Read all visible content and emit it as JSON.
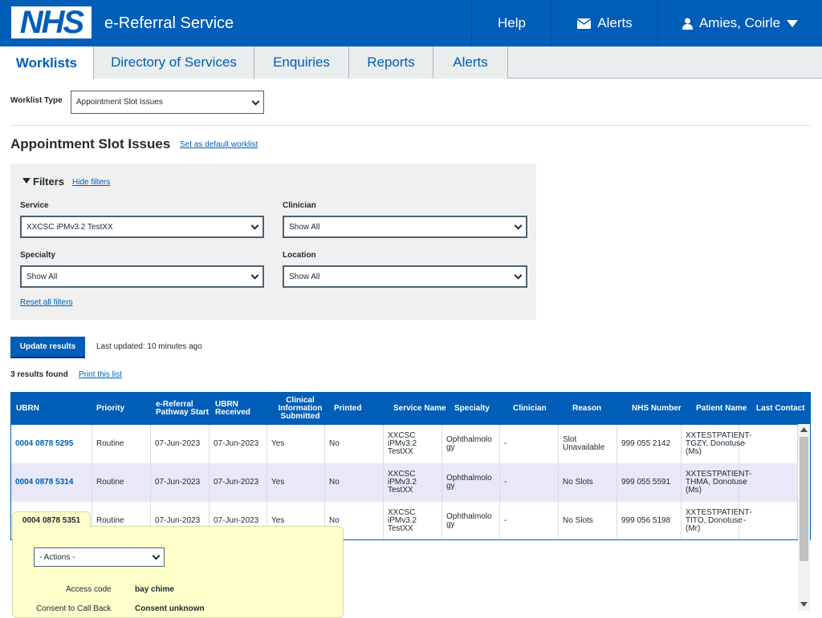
{
  "header": {
    "logo": "NHS",
    "service_name": "e-Referral Service",
    "help": "Help",
    "alerts": "Alerts",
    "user": "Amies, Coirle"
  },
  "tabs": [
    {
      "label": "Worklists",
      "active": true
    },
    {
      "label": "Directory of Services"
    },
    {
      "label": "Enquiries"
    },
    {
      "label": "Reports"
    },
    {
      "label": "Alerts"
    }
  ],
  "worklist_type": {
    "label": "Worklist Type",
    "value": "Appointment Slot Issues"
  },
  "page_title": "Appointment Slot Issues",
  "set_default_link": "Set as default worklist",
  "filters": {
    "title": "Filters",
    "hide_link": "Hide filters",
    "service": {
      "label": "Service",
      "value": "XXCSC iPMv3.2 TestXX"
    },
    "clinician": {
      "label": "Clinician",
      "value": "Show All"
    },
    "specialty": {
      "label": "Specialty",
      "value": "Show All"
    },
    "location": {
      "label": "Location",
      "value": "Show All"
    },
    "reset_link": "Reset all filters"
  },
  "update_button": "Update results",
  "last_updated": "Last updated: 10 minutes ago",
  "results_found": "3 results found",
  "print_link": "Print this list",
  "table": {
    "headers": [
      "UBRN",
      "Priority",
      "e-Referral Pathway Start",
      "UBRN Received",
      "Clinical Information Submitted",
      "Printed",
      "Service Name",
      "Specialty",
      "Clinician",
      "Reason",
      "NHS Number",
      "Patient Name",
      "Last Contact"
    ],
    "rows": [
      [
        "0004 0878 5295",
        "Routine",
        "07-Jun-2023",
        "07-Jun-2023",
        "Yes",
        "No",
        "XXCSC iPMv3.2 TestXX",
        "Ophthalmolo gy",
        "-",
        "Slot Unavailable",
        "999 055 2142",
        "XXTESTPATIENT-TGZY, Donotuse (Ms)",
        "-"
      ],
      [
        "0004 0878 5314",
        "Routine",
        "07-Jun-2023",
        "07-Jun-2023",
        "Yes",
        "No",
        "XXCSC iPMv3.2 TestXX",
        "Ophthalmolo gy",
        "-",
        "No Slots",
        "999 055 5591",
        "XXTESTPATIENT-THMA, Donotuse (Ms)",
        "-"
      ],
      [
        "0004 0878 5351",
        "Routine",
        "07-Jun-2023",
        "07-Jun-2023",
        "Yes",
        "No",
        "XXCSC iPMv3.2 TestXX",
        "Ophthalmolo gy",
        "-",
        "No Slots",
        "999 056 5198",
        "XXTESTPATIENT-TITO, Donotuse (Mr)",
        "-"
      ]
    ]
  },
  "popup": {
    "ubrn": "0004 0878 5351",
    "actions_select": "- Actions -",
    "access_code_label": "Access code",
    "access_code_value": "bay chime",
    "consent_label": "Consent to Call Back",
    "consent_value": "Consent unknown"
  },
  "colors": {
    "nhs_blue": "#005eb8",
    "popup_bg": "#ffffcc",
    "row_alt": "#e8e8f8"
  }
}
